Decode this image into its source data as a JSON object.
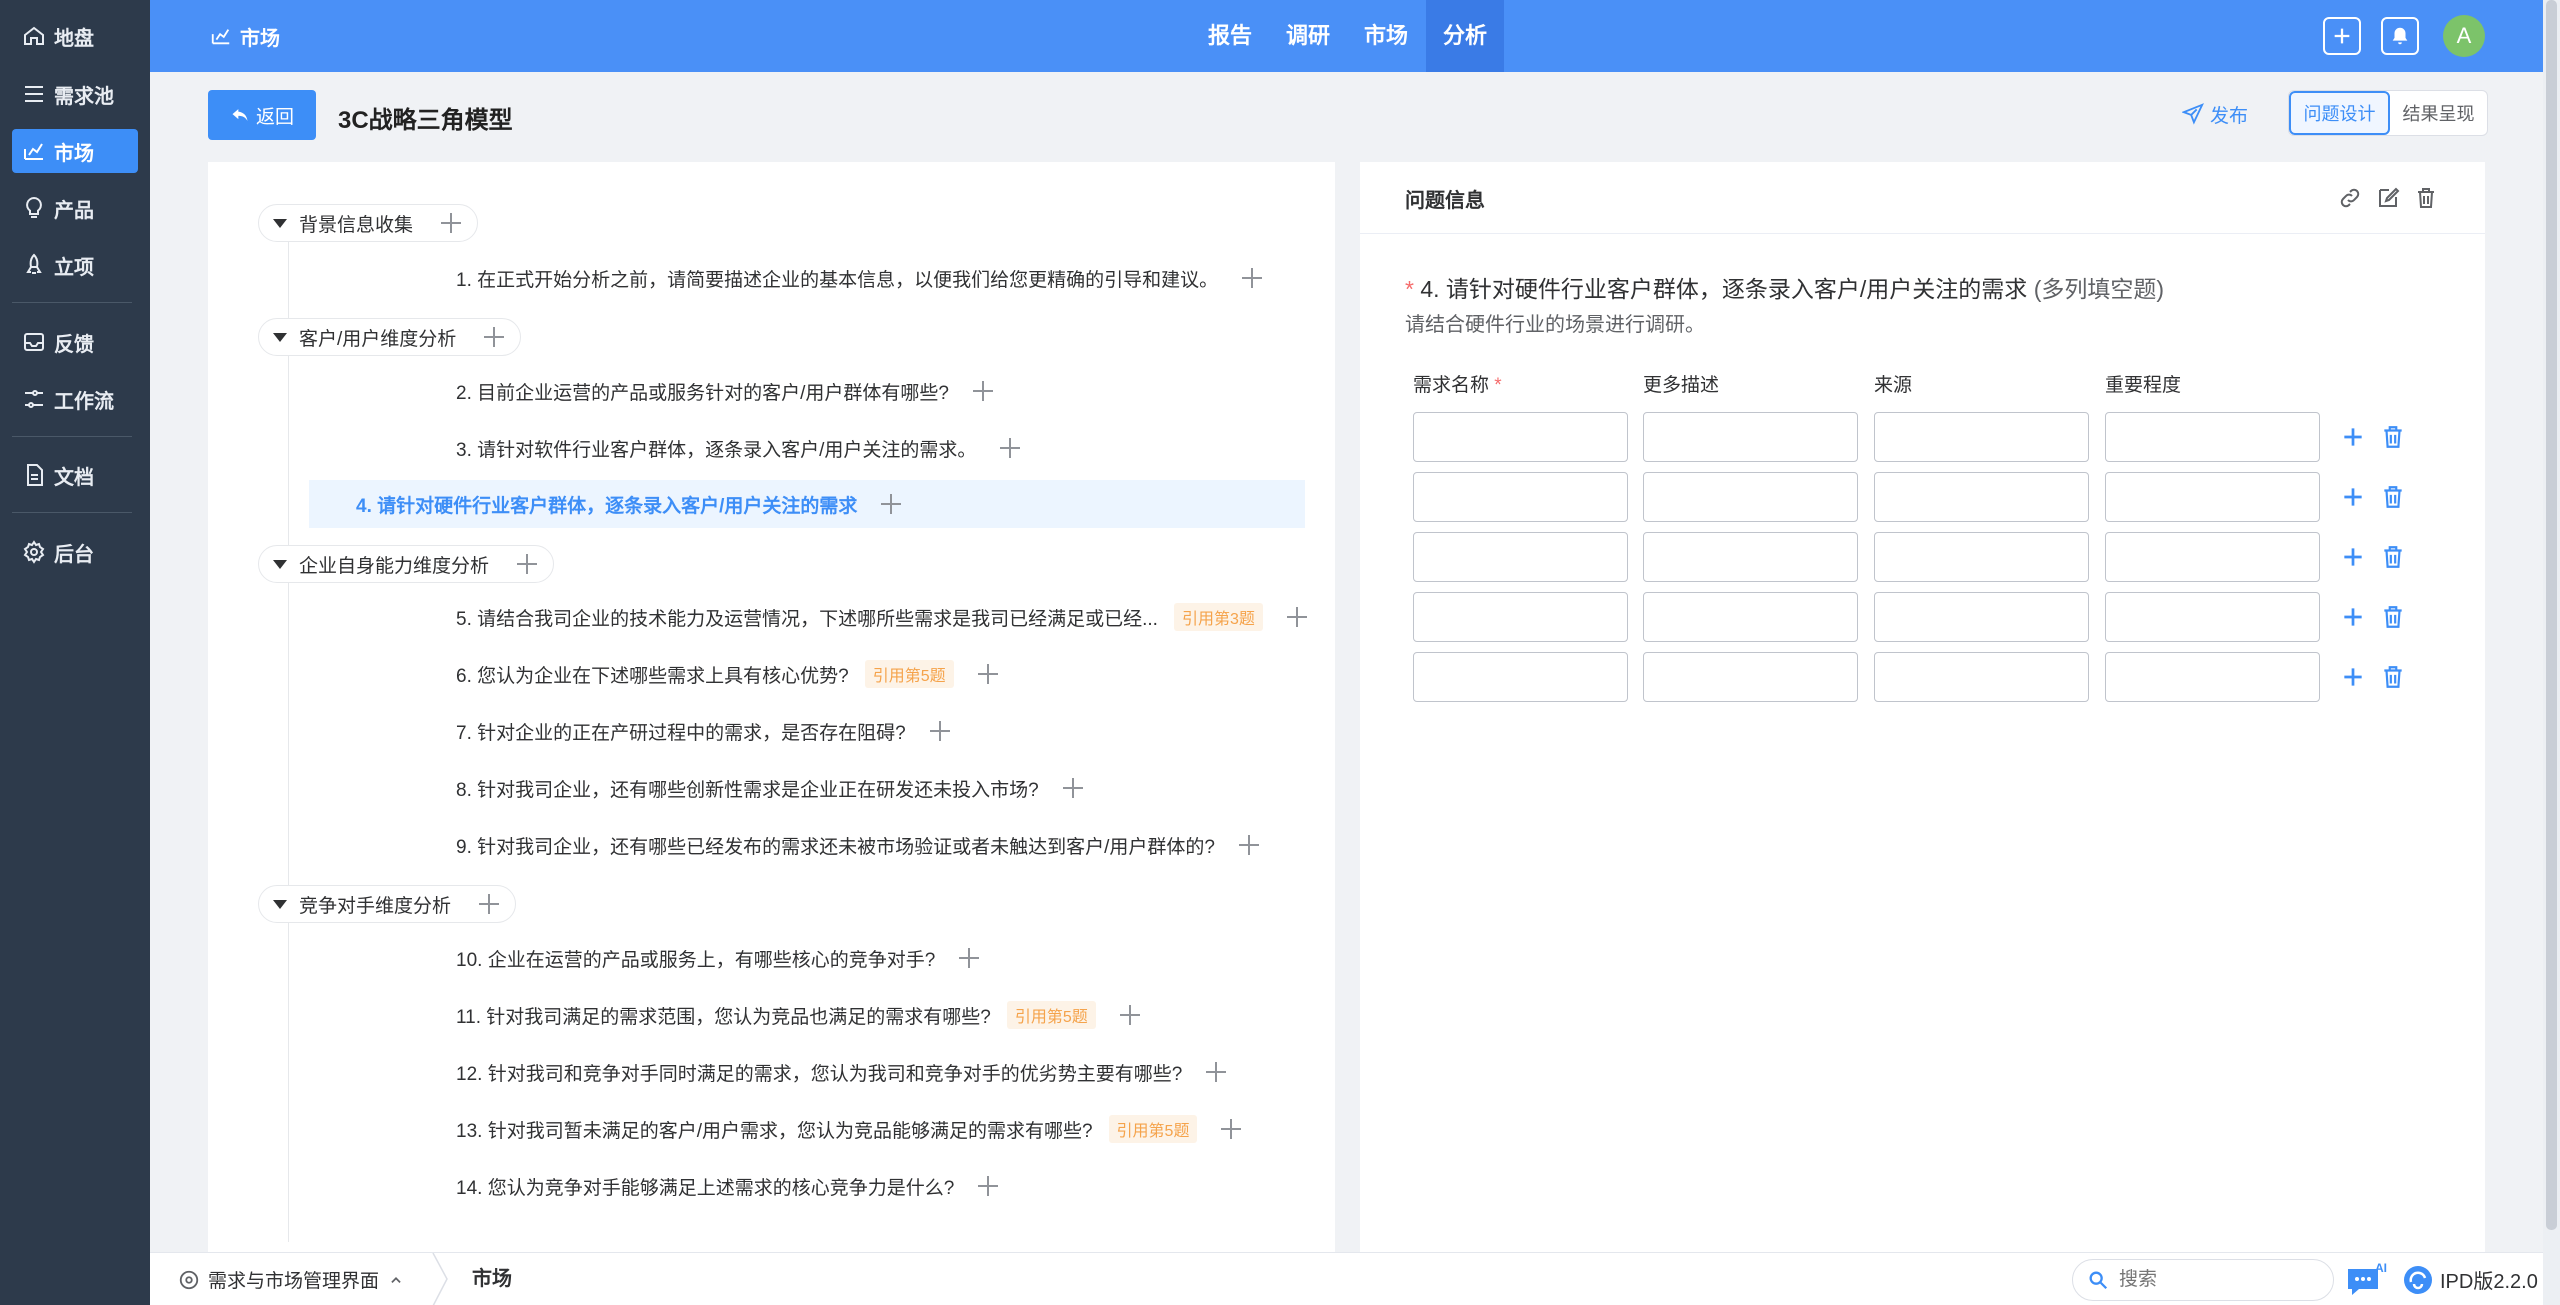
{
  "sidebar": {
    "items": [
      {
        "label": "地盘",
        "icon": "home-icon"
      },
      {
        "label": "需求池",
        "icon": "list-icon"
      },
      {
        "label": "市场",
        "icon": "chart-icon"
      },
      {
        "label": "产品",
        "icon": "bulb-icon"
      },
      {
        "label": "立项",
        "icon": "rocket-icon"
      },
      {
        "label": "反馈",
        "icon": "inbox-icon"
      },
      {
        "label": "工作流",
        "icon": "flow-icon"
      },
      {
        "label": "文档",
        "icon": "document-icon"
      },
      {
        "label": "后台",
        "icon": "gear-icon"
      }
    ],
    "active": "市场"
  },
  "header": {
    "breadcrumb": "市场",
    "nav_tabs": [
      "报告",
      "调研",
      "市场",
      "分析"
    ],
    "active_tab": "分析",
    "avatar_initial": "A"
  },
  "subheader": {
    "back_label": "返回",
    "page_title": "3C战略三角模型",
    "publish_label": "发布",
    "modes": [
      "问题设计",
      "结果呈现"
    ],
    "active_mode": "问题设计"
  },
  "tree": {
    "groups": [
      {
        "label": "背景信息收集",
        "questions": [
          {
            "text": "1. 在正式开始分析之前，请简要描述企业的基本信息，以便我们给您更精确的引导和建议。"
          }
        ]
      },
      {
        "label": "客户/用户维度分析",
        "questions": [
          {
            "text": "2. 目前企业运营的产品或服务针对的客户/用户群体有哪些?"
          },
          {
            "text": "3. 请针对软件行业客户群体，逐条录入客户/用户关注的需求。"
          },
          {
            "text": "4. 请针对硬件行业客户群体，逐条录入客户/用户关注的需求",
            "active": true
          }
        ]
      },
      {
        "label": "企业自身能力维度分析",
        "questions": [
          {
            "text": "5. 请结合我司企业的技术能力及运营情况，下述哪所些需求是我司已经满足或已经...",
            "tag": "引用第3题"
          },
          {
            "text": "6. 您认为企业在下述哪些需求上具有核心优势?",
            "tag": "引用第5题"
          },
          {
            "text": "7. 针对企业的正在产研过程中的需求，是否存在阻碍?"
          },
          {
            "text": "8. 针对我司企业，还有哪些创新性需求是企业正在研发还未投入市场?"
          },
          {
            "text": "9. 针对我司企业，还有哪些已经发布的需求还未被市场验证或者未触达到客户/用户群体的?"
          }
        ]
      },
      {
        "label": "竞争对手维度分析",
        "questions": [
          {
            "text": "10. 企业在运营的产品或服务上，有哪些核心的竞争对手?"
          },
          {
            "text": "11. 针对我司满足的需求范围，您认为竞品也满足的需求有哪些?",
            "tag": "引用第5题"
          },
          {
            "text": "12. 针对我司和竞争对手同时满足的需求，您认为我司和竞争对手的优劣势主要有哪些?"
          },
          {
            "text": "13. 针对我司暂未满足的客户/用户需求，您认为竞品能够满足的需求有哪些?",
            "tag": "引用第5题"
          },
          {
            "text": "14. 您认为竞争对手能够满足上述需求的核心竞争力是什么?"
          }
        ]
      }
    ]
  },
  "question_panel": {
    "title": "问题信息",
    "required_mark": "*",
    "question_title": "4. 请针对硬件行业客户群体，逐条录入客户/用户关注的需求",
    "question_type": "(多列填空题)",
    "description": "请结合硬件行业的场景进行调研。",
    "columns": [
      {
        "label": "需求名称",
        "required": true
      },
      {
        "label": "更多描述",
        "required": false
      },
      {
        "label": "来源",
        "required": false
      },
      {
        "label": "重要程度",
        "required": false
      }
    ],
    "row_count": 5,
    "rows": [
      [
        "",
        "",
        "",
        ""
      ],
      [
        "",
        "",
        "",
        ""
      ],
      [
        "",
        "",
        "",
        ""
      ],
      [
        "",
        "",
        "",
        ""
      ],
      [
        "",
        "",
        "",
        ""
      ]
    ]
  },
  "bottombar": {
    "app_label": "需求与市场管理界面",
    "current_page": "市场",
    "search_placeholder": "搜索",
    "ai_badge": "AI",
    "version": "IPD版2.2.0"
  },
  "colors": {
    "primary": "#3d8ef7",
    "header_bg": "#4a90f7",
    "sidebar_bg": "#2d3a4b",
    "tag_text": "#f5a34b",
    "required": "#f56c6c"
  }
}
